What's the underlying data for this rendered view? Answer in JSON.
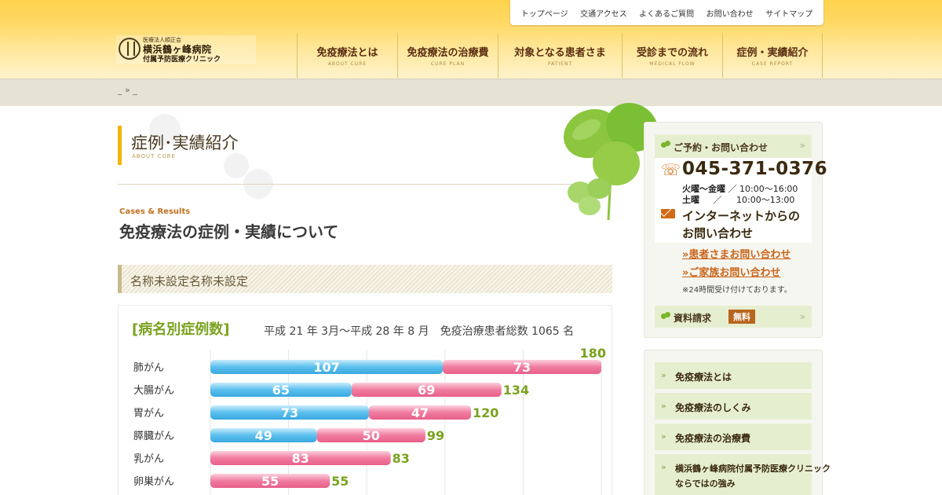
{
  "top_nav": [
    "トップページ",
    "交通アクセス",
    "よくあるご質問",
    "お問い合わせ",
    "サイトマップ"
  ],
  "logo": {
    "corp": "医療法人順正会",
    "name": "横浜鶴ヶ峰病院",
    "sub": "付属予防医療クリニック"
  },
  "main_nav": [
    {
      "jp": "免疫療法とは",
      "en": "ABOUT CURE"
    },
    {
      "jp": "免疫療法の治療費",
      "en": "CURE PLAN"
    },
    {
      "jp": "対象となる患者さま",
      "en": "PATIENT"
    },
    {
      "jp": "受診までの流れ",
      "en": "MEDICAL FLOW"
    },
    {
      "jp": "症例・実績紹介",
      "en": "CASE REPORT"
    }
  ],
  "breadcrumb": "_ » _",
  "page": {
    "title": "症例･実績紹介",
    "title_en": "ABOUT CURE",
    "section_en": "Cases & Results",
    "section_title": "免疫療法の症例・実績について",
    "stripe_text": "名称未設定名称未設定"
  },
  "chart": {
    "heading": "[病名別症例数]",
    "caption": "平成 21 年 3月～平成 28 年 8 月　免疫治療患者総数 1065 名"
  },
  "chart_data": {
    "type": "bar",
    "orientation": "horizontal",
    "stacked": true,
    "categories": [
      "肺がん",
      "大腸がん",
      "胃がん",
      "膵臓がん",
      "乳がん",
      "卵巣がん"
    ],
    "series": [
      {
        "values": [
          107,
          65,
          73,
          49,
          0,
          0
        ],
        "color": "#5bc0ee"
      },
      {
        "values": [
          73,
          69,
          47,
          50,
          83,
          55
        ],
        "color": "#f07ca0"
      }
    ],
    "totals": [
      180,
      134,
      120,
      99,
      83,
      55
    ],
    "xlim": [
      0,
      180
    ],
    "grid": true,
    "total_label_color": "#7aa21e"
  },
  "sidebar": {
    "contact_title": "ご予約・お問い合わせ",
    "phone": "045-371-0376",
    "hours": [
      {
        "day": "火曜～金曜",
        "sep": "／",
        "time": "10:00～16:00"
      },
      {
        "day": "土曜",
        "sep": "／",
        "time": "10:00～13:00"
      }
    ],
    "internet_line1": "インターネットからの",
    "internet_line2": "お問い合わせ",
    "links": [
      "»患者さまお問い合わせ",
      "»ご家族お問い合わせ"
    ],
    "note": "※24時間受け付けております。",
    "material_title": "資料請求",
    "material_badge": "無料",
    "menu": [
      "免疫療法とは",
      "免疫療法のしくみ",
      "免疫療法の治療費",
      "横浜鶴ヶ峰病院付属予防医療クリニック",
      "ならではの強み"
    ]
  },
  "colors": {
    "header_yellow": "#ffd34d",
    "accent_orange": "#c9641a",
    "accent_green": "#7aa21e"
  },
  "icons": [
    "leaf-icon",
    "phone-icon",
    "mail-icon",
    "chevron-right-icon",
    "clover-icon"
  ]
}
